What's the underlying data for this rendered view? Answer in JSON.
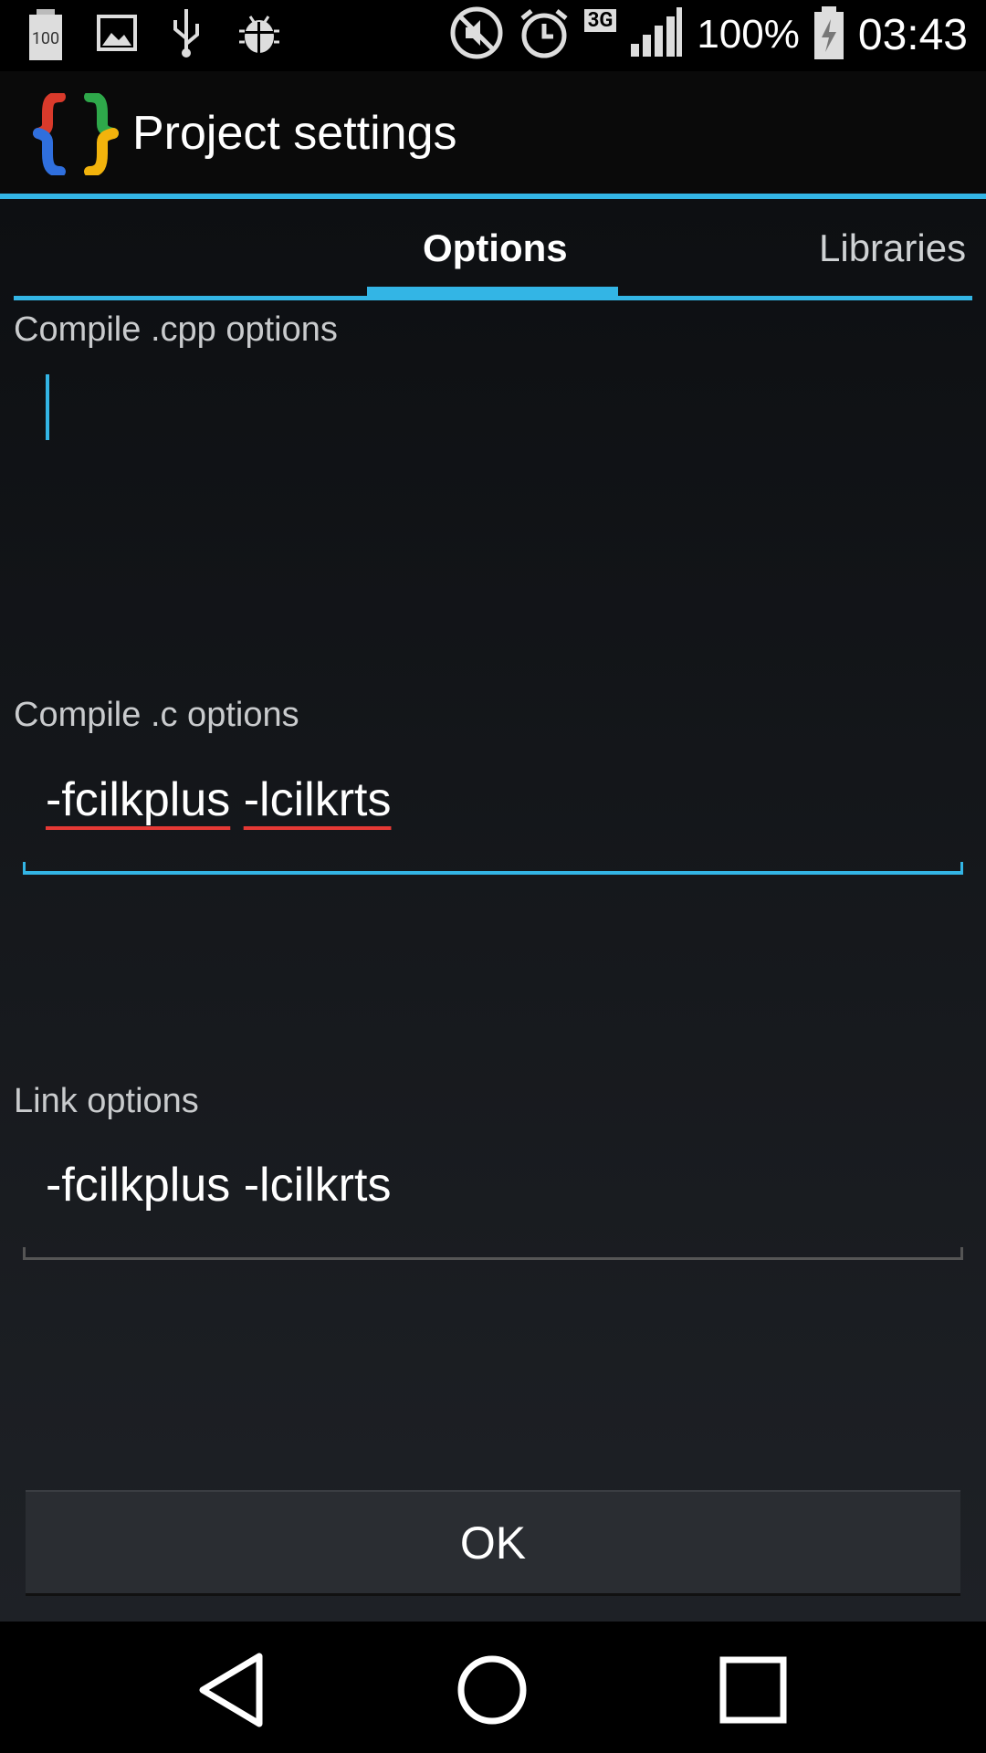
{
  "status_bar": {
    "battery_notification_level": "100",
    "network_type": "3G",
    "battery_percent": "100%",
    "time": "03:43"
  },
  "action_bar": {
    "title": "Project settings"
  },
  "tabs": [
    {
      "label": "Options",
      "selected": true
    },
    {
      "label": "Libraries",
      "selected": false
    }
  ],
  "fields": {
    "cpp": {
      "label": "Compile .cpp options",
      "value": ""
    },
    "c": {
      "label": "Compile .c options",
      "value_part1": "-fcilkplus",
      "value_part2": "-lcilkrts"
    },
    "link": {
      "label": "Link options",
      "value": "-fcilkplus -lcilkrts"
    }
  },
  "ok_button": {
    "label": "OK"
  },
  "colors": {
    "accent": "#33b5e5",
    "spellcheck": "#e53935"
  }
}
